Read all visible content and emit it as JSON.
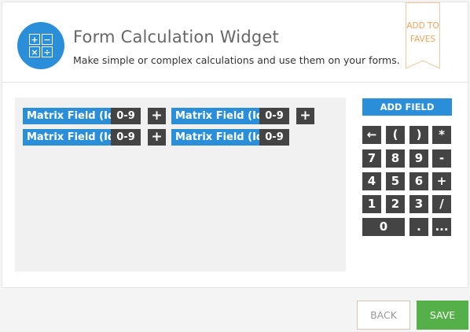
{
  "header": {
    "title": "Form Calculation Widget",
    "subtitle": "Make simple or complex calculations and use them on your forms.",
    "app_icon_symbols": [
      "+",
      "−",
      "×",
      "÷"
    ],
    "fave_line1": "ADD TO",
    "fave_line2": "FAVES"
  },
  "formula": {
    "tokens": [
      {
        "name": "Matrix Field (Id",
        "range": "0-9",
        "operator": "+"
      },
      {
        "name": "Matrix Field (Id",
        "range": "0-9",
        "operator": "+"
      },
      {
        "name": "Matrix Field (Id",
        "range": "0-9",
        "operator": "+"
      },
      {
        "name": "Matrix Field (Id",
        "range": "0-9",
        "operator": ""
      }
    ]
  },
  "keypad": {
    "add_field": "ADD FIELD",
    "keys": [
      "←",
      "(",
      ")",
      "*",
      "7",
      "8",
      "9",
      "-",
      "4",
      "5",
      "6",
      "+",
      "1",
      "2",
      "3",
      "/",
      "0",
      ".",
      "..."
    ]
  },
  "footer": {
    "back": "BACK",
    "save": "SAVE"
  },
  "colors": {
    "accent": "#2a8fd8",
    "dark": "#444444",
    "save": "#56b04a",
    "fave": "#f0a35a"
  }
}
